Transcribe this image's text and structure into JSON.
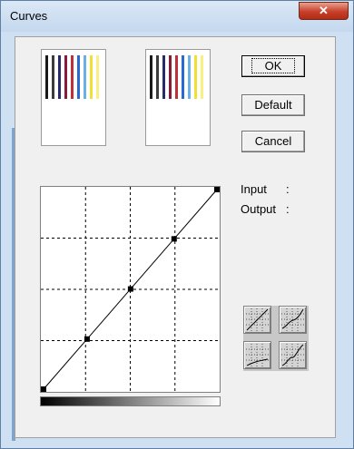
{
  "window": {
    "title": "Curves",
    "close_symbol": "✕"
  },
  "buttons": {
    "ok": "OK",
    "default": "Default",
    "cancel": "Cancel"
  },
  "readout": {
    "input_label": "Input",
    "input_sep": ":",
    "output_label": "Output",
    "output_sep": ":"
  },
  "preview_stripe_colors": [
    "#1a1a1a",
    "#3c3c3c",
    "#2a2a6a",
    "#8a1a3a",
    "#c0303a",
    "#2a6ad0",
    "#6ab0e8",
    "#f2e030",
    "#f8f080"
  ],
  "curve": {
    "control_points": [
      [
        0,
        0
      ],
      [
        64,
        64
      ],
      [
        128,
        128
      ],
      [
        192,
        192
      ],
      [
        255,
        255
      ]
    ],
    "grid": "dashed"
  },
  "presets": [
    {
      "name": "preset-linear"
    },
    {
      "name": "preset-brighten"
    },
    {
      "name": "preset-darken"
    },
    {
      "name": "preset-contrast"
    }
  ]
}
